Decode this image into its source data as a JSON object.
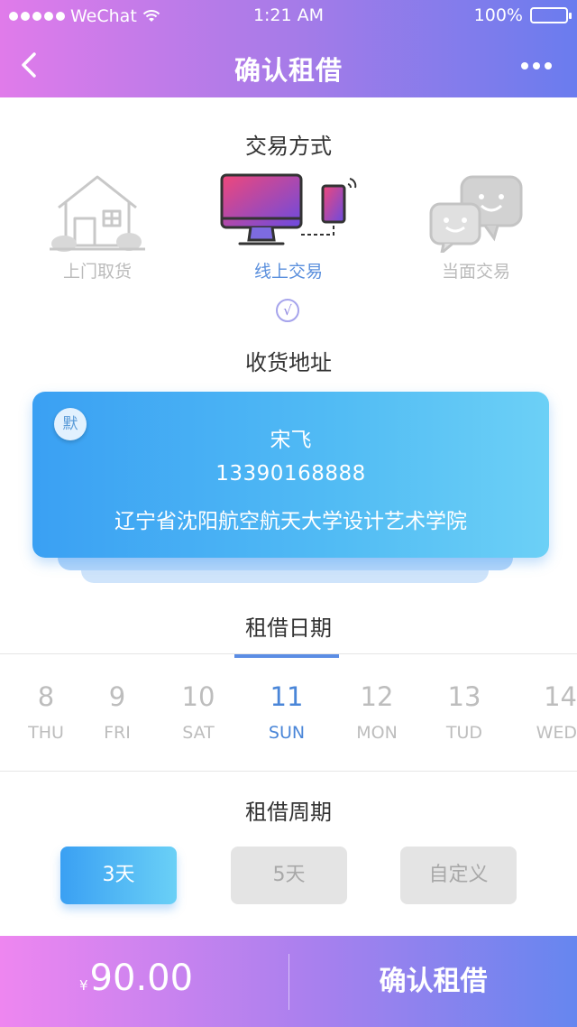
{
  "status_bar": {
    "carrier": "WeChat",
    "time": "1:21 AM",
    "battery": "100%"
  },
  "nav": {
    "title": "确认租借"
  },
  "trade": {
    "title": "交易方式",
    "options": [
      {
        "label": "上门取货",
        "icon": "house-icon"
      },
      {
        "label": "线上交易",
        "icon": "computer-phone-icon",
        "selected": true
      },
      {
        "label": "当面交易",
        "icon": "chat-bubbles-icon"
      }
    ],
    "check": "√"
  },
  "address": {
    "title": "收货地址",
    "badge": "默",
    "name": "宋飞",
    "phone": "13390168888",
    "detail": "辽宁省沈阳航空航天大学设计艺术学院"
  },
  "dates": {
    "title": "租借日期",
    "days": [
      {
        "num": "8",
        "weekday": "THU"
      },
      {
        "num": "9",
        "weekday": "FRI"
      },
      {
        "num": "10",
        "weekday": "SAT"
      },
      {
        "num": "11",
        "weekday": "SUN",
        "selected": true
      },
      {
        "num": "12",
        "weekday": "MON"
      },
      {
        "num": "13",
        "weekday": "TUD"
      },
      {
        "num": "14",
        "weekday": "WED"
      }
    ]
  },
  "period": {
    "title": "租借周期",
    "options": [
      "3天",
      "5天",
      "自定义"
    ],
    "selected": "3天"
  },
  "bottom": {
    "currency": "¥",
    "price": "90.00",
    "confirm": "确认租借"
  },
  "colors": {
    "accent": "#5b8de4",
    "card": "#3aa0f3",
    "header_start": "#e07bea",
    "header_end": "#6a7cee"
  }
}
